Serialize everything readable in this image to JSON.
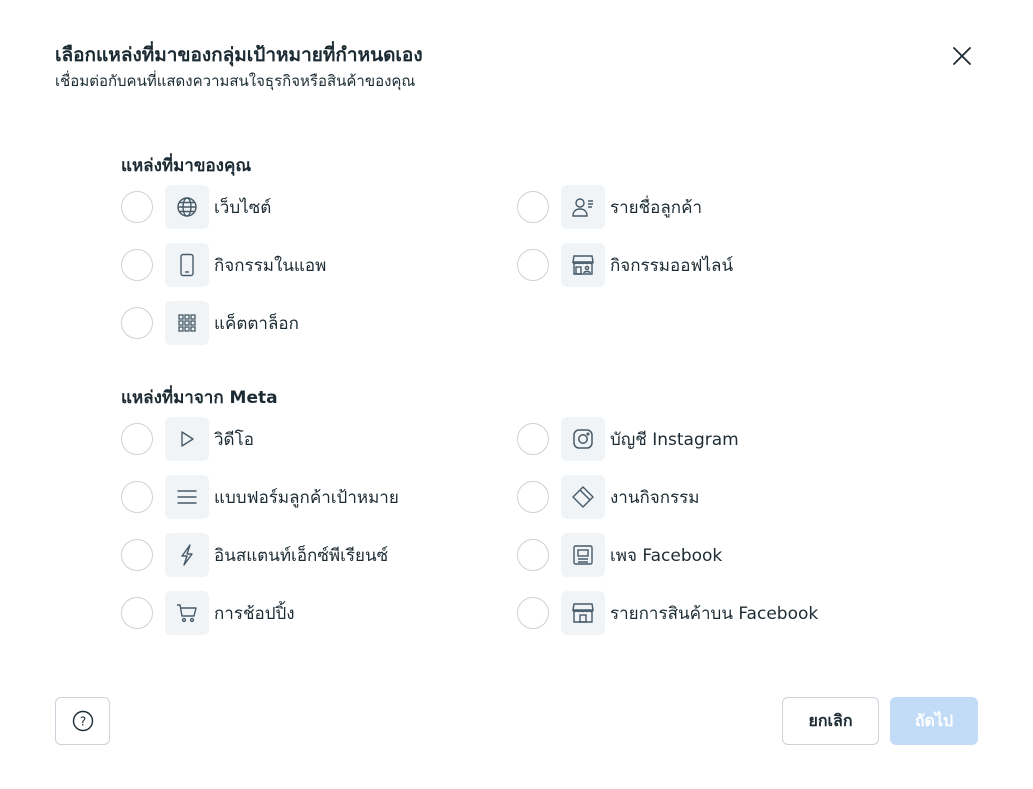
{
  "header": {
    "title": "เลือกแหล่งที่มาของกลุ่มเป้าหมายที่กำหนดเอง",
    "subtitle": "เชื่อมต่อกับคนที่แสดงความสนใจธุรกิจหรือสินค้าของคุณ",
    "close_icon": "close-icon"
  },
  "your_sources": {
    "title": "แหล่งที่มาของคุณ",
    "options": [
      {
        "label": "เว็บไซต์",
        "icon": "globe-icon",
        "selected": false
      },
      {
        "label": "รายชื่อลูกค้า",
        "icon": "customer-list-icon",
        "selected": false
      },
      {
        "label": "กิจกรรมในแอพ",
        "icon": "mobile-app-icon",
        "selected": false
      },
      {
        "label": "กิจกรรมออฟไลน์",
        "icon": "offline-store-icon",
        "selected": false
      },
      {
        "label": "แค็ตตาล็อก",
        "icon": "catalog-grid-icon",
        "selected": false
      }
    ]
  },
  "meta_sources": {
    "title": "แหล่งที่มาจาก Meta",
    "options": [
      {
        "label": "วิดีโอ",
        "icon": "play-icon",
        "selected": false
      },
      {
        "label": "บัญชี Instagram",
        "icon": "instagram-icon",
        "selected": false
      },
      {
        "label": "แบบฟอร์มลูกค้าเป้าหมาย",
        "icon": "lead-form-icon",
        "selected": false
      },
      {
        "label": "งานกิจกรรม",
        "icon": "event-ticket-icon",
        "selected": false
      },
      {
        "label": "อินสแตนท์เอ็กซ์พีเรียนซ์",
        "icon": "lightning-icon",
        "selected": false
      },
      {
        "label": "เพจ Facebook",
        "icon": "facebook-page-icon",
        "selected": false
      },
      {
        "label": "การช้อปปิ้ง",
        "icon": "shopping-cart-icon",
        "selected": false
      },
      {
        "label": "รายการสินค้าบน Facebook",
        "icon": "marketplace-store-icon",
        "selected": false
      }
    ]
  },
  "footer": {
    "help_icon": "help-icon",
    "cancel_label": "ยกเลิก",
    "next_label": "ถัดไป",
    "next_enabled": false
  },
  "colors": {
    "text": "#1c2b33",
    "icon": "#465a69",
    "icon_bg": "#f1f4f7",
    "border": "#cbd2d9",
    "next_disabled_bg": "#c2dcf7"
  }
}
